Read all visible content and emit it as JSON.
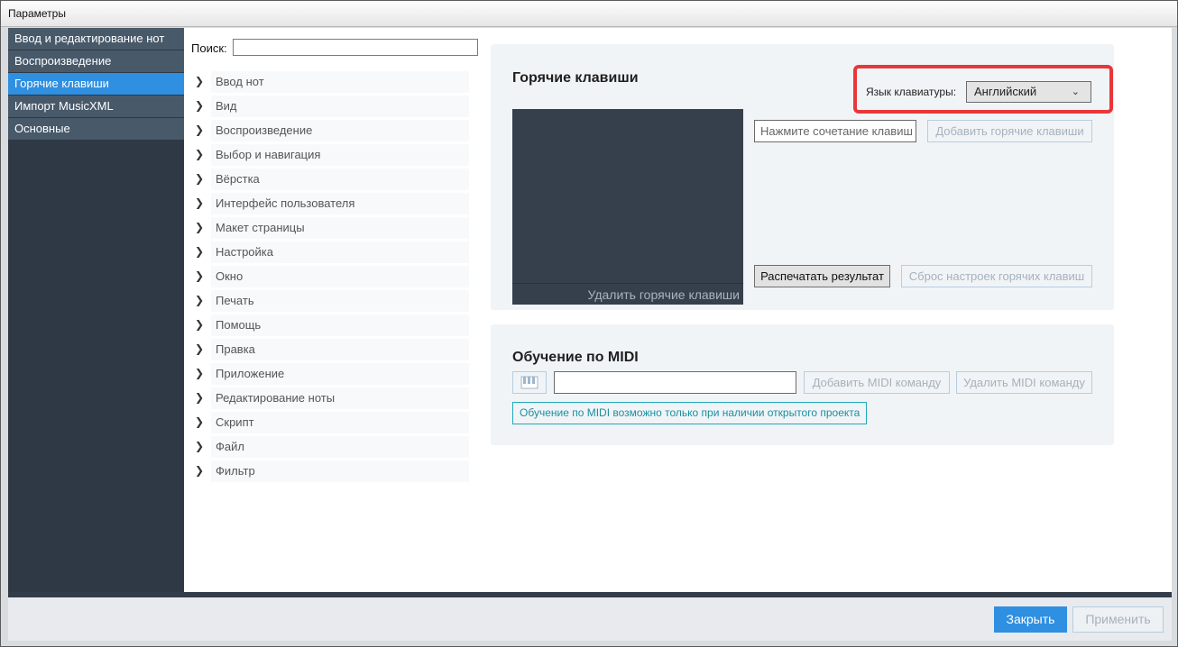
{
  "window": {
    "title": "Параметры"
  },
  "sidebar": {
    "items": [
      {
        "label": "Ввод и редактирование нот",
        "active": false
      },
      {
        "label": "Воспроизведение",
        "active": false
      },
      {
        "label": "Горячие клавиши",
        "active": true
      },
      {
        "label": "Импорт MusicXML",
        "active": false
      },
      {
        "label": "Основные",
        "active": false
      }
    ]
  },
  "search": {
    "label": "Поиск:",
    "value": ""
  },
  "tree": {
    "items": [
      "Ввод нот",
      "Вид",
      "Воспроизведение",
      "Выбор и навигация",
      "Вёрстка",
      "Интерфейс пользователя",
      "Макет страницы",
      "Настройка",
      "Окно",
      "Печать",
      "Помощь",
      "Правка",
      "Приложение",
      "Редактирование ноты",
      "Скрипт",
      "Файл",
      "Фильтр"
    ]
  },
  "hotkeys": {
    "title": "Горячие клавиши",
    "language_label": "Язык клавиатуры:",
    "language_value": "Английский",
    "delete_label": "Удалить горячие клавиши",
    "shortcut_placeholder": "Нажмите сочетание клавиш",
    "add_label": "Добавить горячие клавиши",
    "print_label": "Распечатать результат",
    "reset_label": "Сброс настроек горячих клавиш"
  },
  "midi": {
    "title": "Обучение по MIDI",
    "add_label": "Добавить MIDI команду",
    "delete_label": "Удалить MIDI команду",
    "note": "Обучение по MIDI возможно только при наличии открытого проекта"
  },
  "footer": {
    "close_label": "Закрыть",
    "apply_label": "Применить"
  },
  "colors": {
    "accent": "#2f8fe0",
    "sidebar": "#48596a",
    "highlight": "#e8373a"
  }
}
